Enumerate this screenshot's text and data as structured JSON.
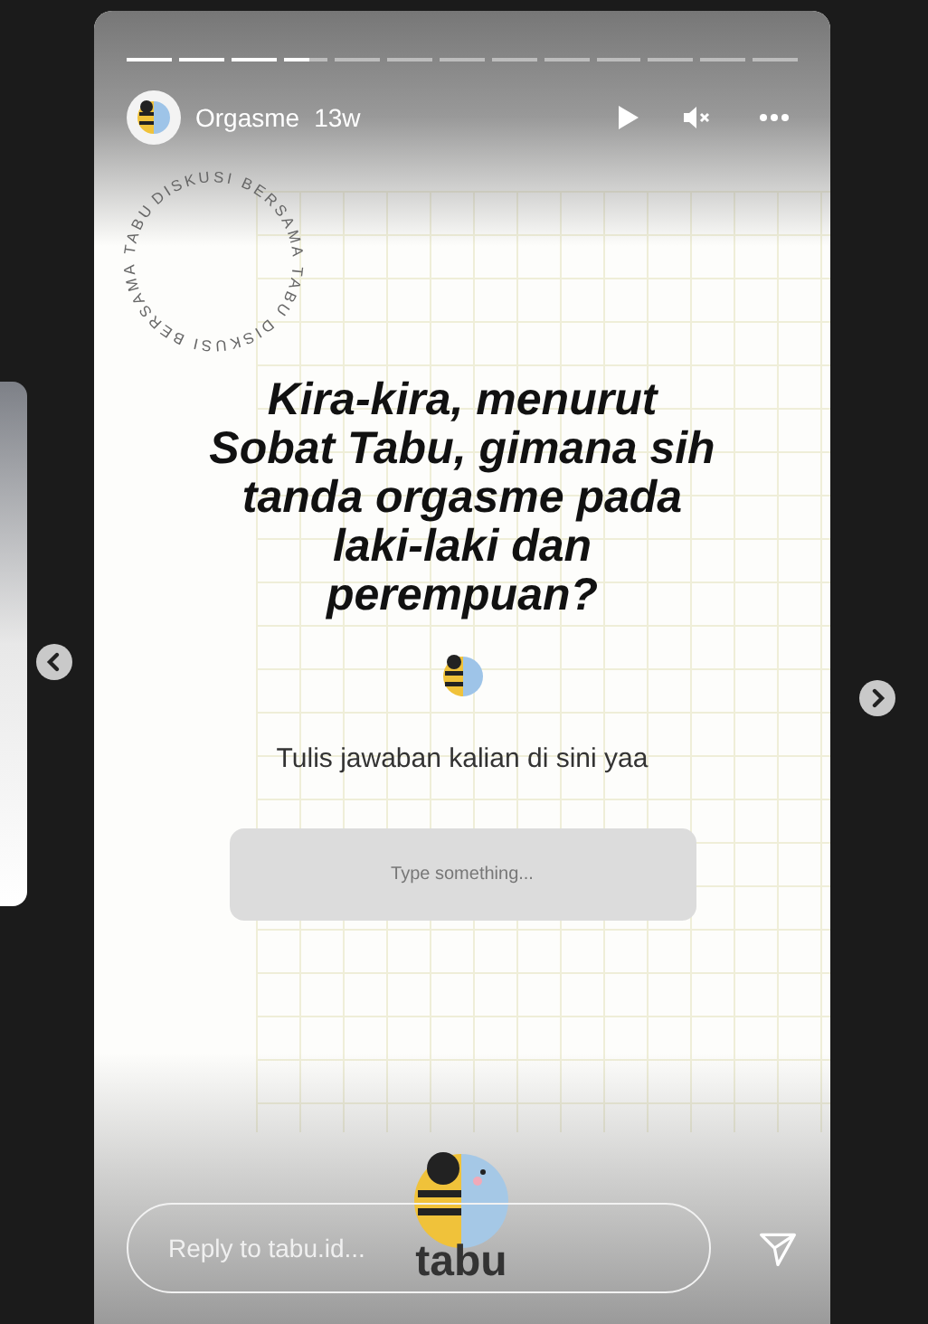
{
  "story": {
    "progress": [
      {
        "viewed": true
      },
      {
        "viewed": true
      },
      {
        "viewed": true
      },
      {
        "viewed": false,
        "level": 0.6
      },
      {
        "viewed": false
      },
      {
        "viewed": false
      },
      {
        "viewed": false
      },
      {
        "viewed": false
      },
      {
        "viewed": false
      },
      {
        "viewed": false
      },
      {
        "viewed": false
      },
      {
        "viewed": false
      },
      {
        "viewed": false
      }
    ],
    "account": "Orgasme",
    "age": "13w",
    "paused": true,
    "muted": true,
    "stamp": "DISKUSI BERSAMA TABU DISKUSI BERSAMA TABU",
    "question": "Kira-kira, menurut Sobat Tabu, gimana sih tanda orgasme pada laki-laki dan perempuan?",
    "prompt": "Tulis jawaban kalian di sini yaa",
    "answer_field": {
      "placeholder": "Type something..."
    },
    "logo_text": "tabu",
    "reply": {
      "placeholder": "Reply to tabu.id..."
    }
  }
}
